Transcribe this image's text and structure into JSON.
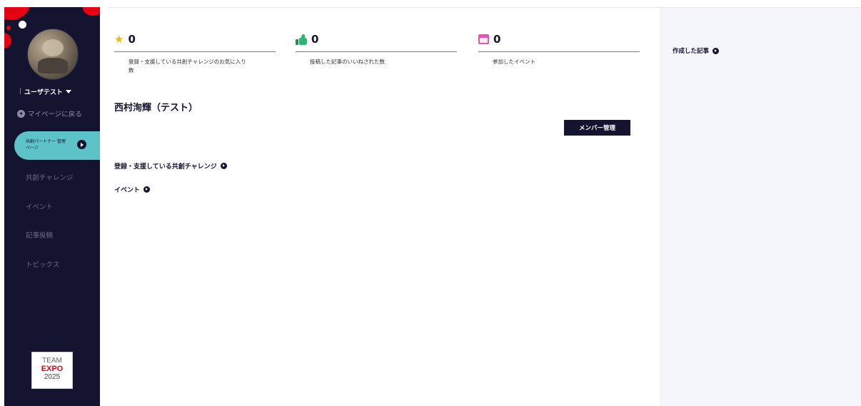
{
  "sidebar": {
    "user_name": "ユーザテスト",
    "back_link": "マイページに戻る",
    "active_item": "共創パートナー 管理ページ",
    "items": [
      "共創チャレンジ",
      "イベント",
      "記事投稿",
      "トピックス"
    ],
    "logo": {
      "line1": "TEAM",
      "line2": "EXPO",
      "line3": "2025"
    },
    "colors": {
      "background": "#141430",
      "accent": "#5ec3c8",
      "brand_red": "#e60012"
    }
  },
  "stats": [
    {
      "icon": "star-icon",
      "value": "0",
      "label": "登録・支援している共創チャレンジのお気に入り数"
    },
    {
      "icon": "thumbs-up-icon",
      "value": "0",
      "label": "投稿した記事のいいねされた数"
    },
    {
      "icon": "calendar-icon",
      "value": "0",
      "label": "参加したイベント"
    }
  ],
  "main": {
    "member_name": "西村洵輝（テスト）",
    "member_button": "メンバー管理",
    "sections": [
      "登録・支援している共創チャレンジ",
      "イベント"
    ]
  },
  "right_panel": {
    "title": "作成した記事"
  }
}
